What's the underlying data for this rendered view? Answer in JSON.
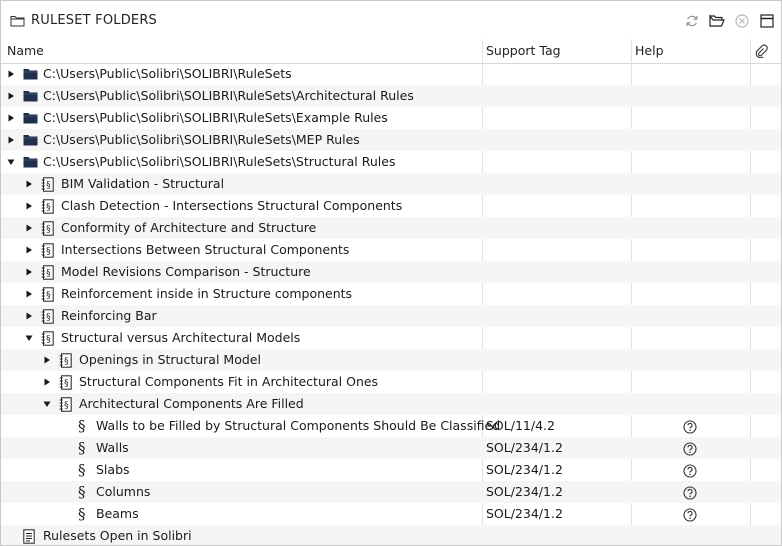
{
  "panel": {
    "title": "RULESET FOLDERS",
    "toolbar_icons": [
      "refresh-icon",
      "open-folder-icon",
      "close-circle-icon",
      "window-icon"
    ]
  },
  "columns": {
    "name": "Name",
    "support_tag": "Support Tag",
    "help": "Help"
  },
  "rows": [
    {
      "label": "C:\\Users\\Public\\Solibri\\SOLIBRI\\RuleSets",
      "level": 0,
      "type": "folder",
      "arrow": "right",
      "tag": "",
      "help": false
    },
    {
      "label": "C:\\Users\\Public\\Solibri\\SOLIBRI\\RuleSets\\Architectural Rules",
      "level": 0,
      "type": "folder",
      "arrow": "right",
      "tag": "",
      "help": false
    },
    {
      "label": "C:\\Users\\Public\\Solibri\\SOLIBRI\\RuleSets\\Example Rules",
      "level": 0,
      "type": "folder",
      "arrow": "right",
      "tag": "",
      "help": false
    },
    {
      "label": "C:\\Users\\Public\\Solibri\\SOLIBRI\\RuleSets\\MEP Rules",
      "level": 0,
      "type": "folder",
      "arrow": "right",
      "tag": "",
      "help": false
    },
    {
      "label": "C:\\Users\\Public\\Solibri\\SOLIBRI\\RuleSets\\Structural Rules",
      "level": 0,
      "type": "folder",
      "arrow": "down",
      "tag": "",
      "help": false
    },
    {
      "label": "BIM Validation - Structural",
      "level": 1,
      "type": "ruleset",
      "arrow": "right",
      "tag": "",
      "help": false
    },
    {
      "label": "Clash Detection - Intersections Structural Components",
      "level": 1,
      "type": "ruleset",
      "arrow": "right",
      "tag": "",
      "help": false
    },
    {
      "label": "Conformity of Architecture and Structure",
      "level": 1,
      "type": "ruleset",
      "arrow": "right",
      "tag": "",
      "help": false
    },
    {
      "label": "Intersections Between Structural Components",
      "level": 1,
      "type": "ruleset",
      "arrow": "right",
      "tag": "",
      "help": false
    },
    {
      "label": "Model Revisions Comparison - Structure",
      "level": 1,
      "type": "ruleset",
      "arrow": "right",
      "tag": "",
      "help": false
    },
    {
      "label": "Reinforcement inside in Structure components",
      "level": 1,
      "type": "ruleset",
      "arrow": "right",
      "tag": "",
      "help": false
    },
    {
      "label": "Reinforcing Bar",
      "level": 1,
      "type": "ruleset",
      "arrow": "right",
      "tag": "",
      "help": false
    },
    {
      "label": "Structural versus Architectural Models",
      "level": 1,
      "type": "ruleset",
      "arrow": "down",
      "tag": "",
      "help": false
    },
    {
      "label": "Openings in Structural Model",
      "level": 2,
      "type": "ruleset",
      "arrow": "right",
      "tag": "",
      "help": false
    },
    {
      "label": "Structural Components Fit in Architectural Ones",
      "level": 2,
      "type": "ruleset",
      "arrow": "right",
      "tag": "",
      "help": false
    },
    {
      "label": "Architectural Components Are Filled",
      "level": 2,
      "type": "ruleset",
      "arrow": "down",
      "tag": "",
      "help": false
    },
    {
      "label": "Walls to be Filled by Structural Components Should Be Classified",
      "level": 3,
      "type": "rule",
      "arrow": "",
      "tag": "SOL/11/4.2",
      "help": true
    },
    {
      "label": "Walls",
      "level": 3,
      "type": "rule",
      "arrow": "",
      "tag": "SOL/234/1.2",
      "help": true
    },
    {
      "label": "Slabs",
      "level": 3,
      "type": "rule",
      "arrow": "",
      "tag": "SOL/234/1.2",
      "help": true
    },
    {
      "label": "Columns",
      "level": 3,
      "type": "rule",
      "arrow": "",
      "tag": "SOL/234/1.2",
      "help": true
    },
    {
      "label": "Beams",
      "level": 3,
      "type": "rule",
      "arrow": "",
      "tag": "SOL/234/1.2",
      "help": true
    },
    {
      "label": "Rulesets Open in Solibri",
      "level": 0,
      "type": "document",
      "arrow": "",
      "tag": "",
      "help": false
    }
  ]
}
